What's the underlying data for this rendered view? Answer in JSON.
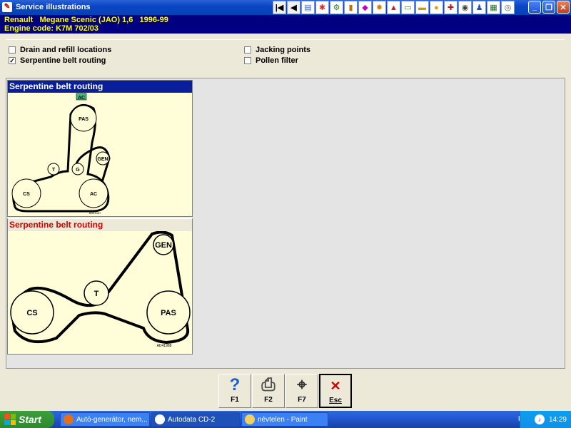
{
  "window": {
    "title": "Service illustrations"
  },
  "toolbar": {
    "icons": [
      "first-icon",
      "prev-icon",
      "book-icon",
      "wrench-icon",
      "engine-icon",
      "drill-icon",
      "tag-icon",
      "gear-icon",
      "car-icon",
      "window-icon",
      "battery-icon",
      "bulb-icon",
      "tools-icon",
      "tyre-icon",
      "person-icon",
      "chart-icon",
      "cd-icon"
    ]
  },
  "vehicle": {
    "line1": "Renault   Megane Scenic (JAO) 1,6   1996-99",
    "line2": "Engine code: K7M 702/03"
  },
  "options": [
    {
      "label": "Drain and refill locations",
      "checked": false
    },
    {
      "label": "Serpentine belt routing",
      "checked": true
    },
    {
      "label": "Jacking points",
      "checked": false
    },
    {
      "label": "Pollen filter",
      "checked": false
    }
  ],
  "illustrations": [
    {
      "title": "Serpentine belt routing",
      "ac_tag": "AC",
      "code": "AD41987",
      "pulleys": [
        "PAS",
        "GEN",
        "T",
        "G",
        "CS",
        "AC"
      ]
    },
    {
      "title": "Serpentine belt routing",
      "code": "AD41988",
      "pulleys": [
        "GEN",
        "T",
        "CS",
        "PAS"
      ]
    }
  ],
  "buttons": [
    {
      "key": "F1",
      "icon": "help-icon"
    },
    {
      "key": "F2",
      "icon": "printer-icon"
    },
    {
      "key": "F7",
      "icon": "magnifier-icon"
    },
    {
      "key": "Esc",
      "icon": "close-icon"
    }
  ],
  "taskbar": {
    "start": "Start",
    "tasks": [
      "Autó-generátor, nem...",
      "Autodata CD-2",
      "névtelen - Paint"
    ],
    "lang": "HU",
    "time": "14:29"
  }
}
